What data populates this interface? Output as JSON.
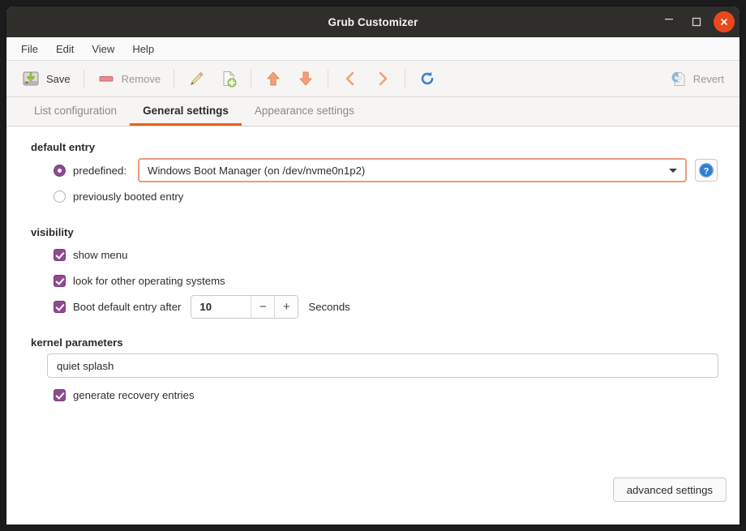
{
  "window": {
    "title": "Grub Customizer",
    "controls": {
      "minimize": "minimize",
      "maximize": "maximize",
      "close": "close"
    }
  },
  "menubar": {
    "items": [
      {
        "label": "File"
      },
      {
        "label": "Edit"
      },
      {
        "label": "View"
      },
      {
        "label": "Help"
      }
    ]
  },
  "toolbar": {
    "save_label": "Save",
    "remove_label": "Remove",
    "revert_label": "Revert",
    "icons": {
      "save": "save-disk-icon",
      "remove": "remove-icon",
      "edit": "pencil-icon",
      "new": "new-document-icon",
      "up": "arrow-up-icon",
      "down": "arrow-down-icon",
      "left": "chevron-left-icon",
      "right": "chevron-right-icon",
      "reload": "reload-icon",
      "revert": "revert-icon"
    }
  },
  "tabs": [
    {
      "label": "List configuration",
      "active": false
    },
    {
      "label": "General settings",
      "active": true
    },
    {
      "label": "Appearance settings",
      "active": false
    }
  ],
  "sections": {
    "default_entry": {
      "title": "default entry",
      "predefined_label": "predefined:",
      "predefined_selected": true,
      "combo_value": "Windows Boot Manager (on /dev/nvme0n1p2)",
      "help_glyph": "?",
      "previous_label": "previously booted entry",
      "previous_selected": false
    },
    "visibility": {
      "title": "visibility",
      "items": [
        {
          "label": "show menu",
          "checked": true
        },
        {
          "label": "look for other operating systems",
          "checked": true
        },
        {
          "label": "Boot default entry after",
          "checked": true
        }
      ],
      "timeout_value": "10",
      "decrement_label": "−",
      "increment_label": "+",
      "unit_label": "Seconds"
    },
    "kernel_parameters": {
      "title": "kernel parameters",
      "value": "quiet splash",
      "placeholder": "",
      "recovery_label": "generate recovery entries",
      "recovery_checked": true
    }
  },
  "footer": {
    "advanced_label": "advanced settings"
  },
  "colors": {
    "titlebar": "#2f2e2b",
    "close_button": "#e8491c",
    "accent_tab": "#e8631c",
    "check_purple": "#904a8f",
    "focus_border": "#ed9b7b"
  }
}
